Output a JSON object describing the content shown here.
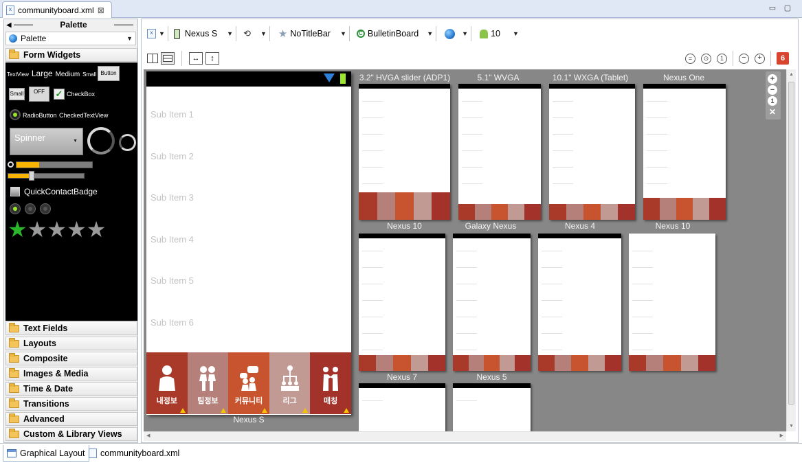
{
  "editor_tab": {
    "filename": "communityboard.xml",
    "close": "⊠"
  },
  "window_buttons": {
    "minimize": "▭",
    "maximize": "▢"
  },
  "palette": {
    "title": "Palette",
    "selector": "Palette",
    "open_category": "Form Widgets",
    "widgets": {
      "textview": "TextView",
      "large": "Large",
      "medium": "Medium",
      "small": "Small",
      "button": "Button",
      "small_button": "Small",
      "toggle_off": "OFF",
      "checkbox": "CheckBox",
      "radiobutton": "RadioButton",
      "checkedtextview": "CheckedTextView",
      "spinner": "Spinner",
      "quickcontactbadge": "QuickContactBadge"
    },
    "categories": [
      "Text Fields",
      "Layouts",
      "Composite",
      "Images & Media",
      "Time & Date",
      "Transitions",
      "Advanced",
      "Custom & Library Views"
    ]
  },
  "toolbar": {
    "device": "Nexus S",
    "theme": "NoTitleBar",
    "activity": "BulletinBoard",
    "api_level": "10",
    "error_count": "6"
  },
  "main_device": {
    "label": "Nexus S",
    "sub_items": [
      "Sub Item 1",
      "Sub Item 2",
      "Sub Item 3",
      "Sub Item 4",
      "Sub Item 5",
      "Sub Item 6"
    ],
    "nav_tabs": [
      {
        "label": "내정보",
        "color": "#a93a2a",
        "icon": "person-icon"
      },
      {
        "label": "팀정보",
        "color": "#b6807a",
        "icon": "team-icon"
      },
      {
        "label": "커뮤니티",
        "color": "#c8542f",
        "icon": "community-icon"
      },
      {
        "label": "리그",
        "color": "#c29a94",
        "icon": "league-icon"
      },
      {
        "label": "매칭",
        "color": "#a2322a",
        "icon": "match-icon"
      }
    ]
  },
  "preview_labels": {
    "hvga": "3.2\" HVGA slider (ADP1)",
    "wvga": "5.1\" WVGA",
    "wxga": "10.1\" WXGA (Tablet)",
    "nexus_one": "Nexus One",
    "nexus10_a": "Nexus 10",
    "galaxy_nexus": "Galaxy Nexus",
    "nexus4": "Nexus 4",
    "nexus10_b": "Nexus 10",
    "nexus7": "Nexus 7",
    "nexus5": "Nexus 5"
  },
  "bottom_tabs": {
    "graphical_layout": "Graphical Layout",
    "xml": "communityboard.xml"
  }
}
